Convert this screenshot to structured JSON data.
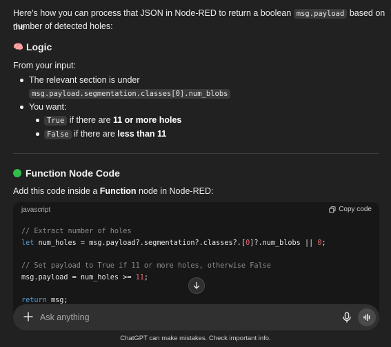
{
  "intro": {
    "line1_before": "Here's how you can process that JSON in Node-RED to return a boolean",
    "line1_code": "msg.payload",
    "line1_after": "based on the",
    "line2": "number of detected holes:"
  },
  "logic": {
    "emoji": "🧠",
    "heading": "Logic",
    "from_input": "From your input:",
    "bullet1_text": "The relevant section is under",
    "bullet1_code": "msg.payload.segmentation.classes[0].num_blobs",
    "bullet2_text": "You want:",
    "sub1_code": "True",
    "sub1_text": "if there are",
    "sub1_bold": "11 or more holes",
    "sub2_code": "False",
    "sub2_text": "if there are",
    "sub2_bold": "less than 11"
  },
  "function_section": {
    "heading": "Function Node Code",
    "desc_before": "Add this code inside a",
    "desc_bold": "Function",
    "desc_after": "node in Node-RED:"
  },
  "code_block": {
    "language": "javascript",
    "copy_label": "Copy code",
    "line1_comment": "// Extract number of holes",
    "line2_kw": "let",
    "line2_mid": " num_holes = msg.payload?.segmentation?.classes?.[",
    "line2_idx": "0",
    "line2_tail": "]?.num_blobs || ",
    "line2_default": "0",
    "line2_end": ";",
    "line3_comment": "// Set payload to True if 11 or more holes, otherwise False",
    "line4_start": "msg.payload = num_holes >= ",
    "line4_num": "11",
    "line4_end": ";",
    "line5_kw": "return",
    "line5_rest": " msg;"
  },
  "composer": {
    "placeholder": "Ask anything"
  },
  "footer": {
    "disclaimer": "ChatGPT can make mistakes. Check important info."
  },
  "colors": {
    "background": "#212121",
    "code_bg": "#171717",
    "composer_bg": "#303030",
    "green_dot": "#2fbf4a"
  }
}
